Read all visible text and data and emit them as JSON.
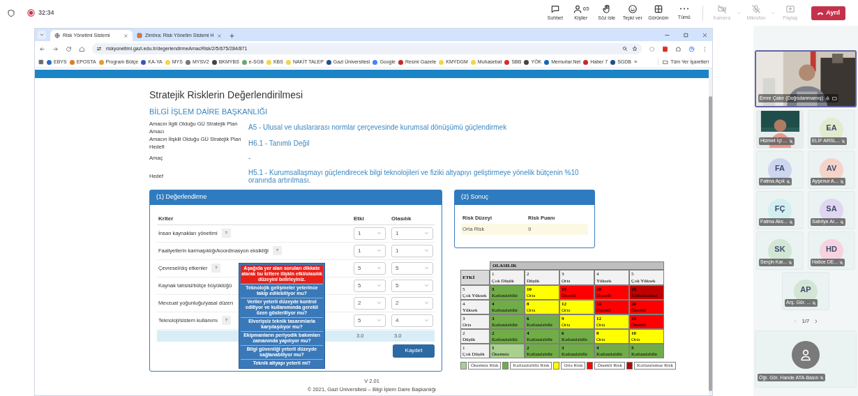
{
  "meeting_bar": {
    "timer": "32:34",
    "buttons": [
      {
        "kind": "chat",
        "label": "Sohbet",
        "disabled": false,
        "has_menu": false
      },
      {
        "kind": "people",
        "label": "Kişiler",
        "count": "65",
        "disabled": false,
        "has_menu": false
      },
      {
        "kind": "hand",
        "label": "Söz iste",
        "disabled": false,
        "has_menu": false
      },
      {
        "kind": "smile",
        "label": "Tepki ver",
        "disabled": false,
        "has_menu": false
      },
      {
        "kind": "grid",
        "label": "Görünüm",
        "disabled": false,
        "has_menu": false
      },
      {
        "kind": "more",
        "label": "Tümü",
        "disabled": false,
        "has_menu": false
      },
      {
        "kind": "camera",
        "label": "Kamera",
        "disabled": true,
        "has_menu": true
      },
      {
        "kind": "mic",
        "label": "Mikrofon",
        "disabled": true,
        "has_menu": true
      },
      {
        "kind": "share",
        "label": "Paylaş",
        "disabled": true,
        "has_menu": false
      }
    ],
    "leave": "Ayrıl"
  },
  "browser": {
    "tabs": [
      {
        "title": "Risk Yönetimi Sistemi",
        "selected": true
      },
      {
        "title": "Zimbra: Risk Yönetim Sistemi H",
        "selected": false
      }
    ],
    "url": "riskyonetimi.gazi.edu.tr/degerlendirmeAmacRisk/2/5/675/284/871",
    "bookmarks": [
      {
        "label": "EBYS",
        "color": "#2b6cc4"
      },
      {
        "label": "EPOSTA",
        "color": "#e07b22"
      },
      {
        "label": "Program Bütçe",
        "color": "#e89a2c"
      },
      {
        "label": "KA-YA",
        "color": "#3a55b8"
      },
      {
        "label": "MYS",
        "color": "#f2d64b"
      },
      {
        "label": "MYSV2",
        "color": "#777777"
      },
      {
        "label": "BKMYBS",
        "color": "#444444"
      },
      {
        "label": "e-SGB",
        "color": "#6aa86a"
      },
      {
        "label": "KBS",
        "color": "#f2d64b"
      },
      {
        "label": "NAKİT TALEP",
        "color": "#f2d64b"
      },
      {
        "label": "Gazi Üniversitesi",
        "color": "#1f4e8c"
      },
      {
        "label": "Google",
        "color": "#4285f4"
      },
      {
        "label": "Resmi Gazete",
        "color": "#c62828"
      },
      {
        "label": "KMYDGM",
        "color": "#f2d64b"
      },
      {
        "label": "Muhasebat",
        "color": "#f2d64b"
      },
      {
        "label": "SBB",
        "color": "#d32f2f"
      },
      {
        "label": "YÖK",
        "color": "#444444"
      },
      {
        "label": "Memurlar.Net",
        "color": "#1565c0"
      },
      {
        "label": "Haber 7",
        "color": "#c62828"
      },
      {
        "label": "SGDB",
        "color": "#1f4e8c"
      }
    ],
    "more": "»",
    "all_bookmarks": "Tüm Yer İşaretleri"
  },
  "page": {
    "title": "Stratejik Risklerin Değerlendirilmesi",
    "department": "BİLGİ İŞLEM DAİRE BAŞKANLIĞI",
    "fields": [
      {
        "label": "Amacın İlgili Olduğu GÜ Stratejik Plan Amacı",
        "value": "A5 - Ulusal ve uluslararası normlar çerçevesinde kurumsal dönüşümü güçlendirmek"
      },
      {
        "label": "Amacın İlişkili Olduğu GÜ Stratejik Plan Hedefi",
        "value": "H6.1 - Tanımlı Değil"
      },
      {
        "label": "Amaç",
        "value": "-"
      },
      {
        "label": "Hedef",
        "value": "H5.1 - Kurumsallaşmayı güçlendirecek bilgi teknolojileri ve fiziki altyapıyı geliştirmeye yönelik bütçenin %10 oranında artırılması."
      }
    ],
    "evaluation": {
      "title": "(1) Değerlendirme",
      "columns": [
        "Kriter",
        "Etki",
        "Olasılık"
      ],
      "rows": [
        {
          "criterion": "İnsan kaynakları yönetimi",
          "help": true,
          "etki": "1",
          "olasilik": "1"
        },
        {
          "criterion": "Faaliyetlerin karmaşıklığı/koordinasyon eksikliği",
          "help": true,
          "etki": "1",
          "olasilik": "1"
        },
        {
          "criterion": "Çevresel/dış etkenler",
          "help": true,
          "etki": "5",
          "olasilik": "5"
        },
        {
          "criterion": "Kaynak tahsisi/bütçe büyüklüğü",
          "help": false,
          "etki": "5",
          "olasilik": "5"
        },
        {
          "criterion": "Mevzuat yoğunluğu/yasal düzen",
          "help": false,
          "etki": "2",
          "olasilik": "2"
        },
        {
          "criterion": "Teknoloji/sistem kullanımı",
          "help": true,
          "etki": "5",
          "olasilik": "4"
        }
      ],
      "totals": [
        "3.0",
        "3.0"
      ],
      "save": "Kaydet",
      "help_label": "?"
    },
    "tooltip": {
      "header": "Aşağıda yer alan soruları dikkate alarak bu kritere ilişkin etki/olasılık düzeyini belirleyiniz.",
      "questions": [
        "Teknolojik gelişmeler yeterince takip edilebiliyor mu?",
        "Veriler yeterli düzeyde kontrol ediliyor ve kullanımında gerekli özen gösteriliyor mu?",
        "Elverişsiz teknik tasarımlarla karşılaşılıyor mu?",
        "Ekipmanların periyodik bakımları zamanında yapılıyor mu?",
        "Bilgi güvenliği yeterli düzeyde sağlanabiliyor mu?",
        "Teknik altyapı yeterli mi?"
      ]
    },
    "result": {
      "title": "(2) Sonuç",
      "columns": [
        "Risk Düzeyi",
        "Risk Puanı"
      ],
      "rows": [
        [
          "Orta Risk",
          "9"
        ]
      ]
    },
    "matrix": {
      "header": "OLASILIK",
      "corner": "ETKİ",
      "columns": [
        {
          "num": "1",
          "label": "Çok Düşük"
        },
        {
          "num": "2",
          "label": "Düşük"
        },
        {
          "num": "3",
          "label": "Orta"
        },
        {
          "num": "4",
          "label": "Yüksek"
        },
        {
          "num": "5",
          "label": "Çok Yüksek"
        }
      ],
      "rows": [
        {
          "num": "5",
          "label": "Çok Yüksek",
          "cells": [
            {
              "score": "5",
              "label": "Katlanılabilir",
              "color": "#70ad47"
            },
            {
              "score": "10",
              "label": "Orta",
              "color": "#ffff00"
            },
            {
              "score": "15",
              "label": "Önemli",
              "color": "#ff0000"
            },
            {
              "score": "20",
              "label": "Önemli",
              "color": "#ff0000"
            },
            {
              "score": "25",
              "label": "Katlanılamaz",
              "color": "#c00000"
            }
          ]
        },
        {
          "num": "4",
          "label": "Yüksek",
          "cells": [
            {
              "score": "4",
              "label": "Katlanılabilir",
              "color": "#70ad47"
            },
            {
              "score": "8",
              "label": "Orta",
              "color": "#ffff00"
            },
            {
              "score": "12",
              "label": "Orta",
              "color": "#ffff00"
            },
            {
              "score": "16",
              "label": "Önemli",
              "color": "#ff0000"
            },
            {
              "score": "20",
              "label": "Önemli",
              "color": "#ff0000"
            }
          ]
        },
        {
          "num": "3",
          "label": "Orta",
          "cells": [
            {
              "score": "3",
              "label": "Katlanılabilir",
              "color": "#70ad47"
            },
            {
              "score": "6",
              "label": "Katlanılabilir",
              "color": "#70ad47"
            },
            {
              "score": "9",
              "label": "Orta",
              "color": "#ffff00"
            },
            {
              "score": "12",
              "label": "Orta",
              "color": "#ffff00"
            },
            {
              "score": "15",
              "label": "Önemli",
              "color": "#ff0000"
            }
          ]
        },
        {
          "num": "2",
          "label": "Düşük",
          "cells": [
            {
              "score": "2",
              "label": "Katlanılabilir",
              "color": "#70ad47"
            },
            {
              "score": "4",
              "label": "Katlanılabilir",
              "color": "#70ad47"
            },
            {
              "score": "6",
              "label": "Katlanılabilir",
              "color": "#70ad47"
            },
            {
              "score": "8",
              "label": "Orta",
              "color": "#ffff00"
            },
            {
              "score": "10",
              "label": "Orta",
              "color": "#ffff00"
            }
          ]
        },
        {
          "num": "1",
          "label": "Çok Düşük",
          "cells": [
            {
              "score": "1",
              "label": "Önemsiz",
              "color": "#a9d08e"
            },
            {
              "score": "2",
              "label": "Katlanılabilir",
              "color": "#70ad47"
            },
            {
              "score": "3",
              "label": "Katlanılabilir",
              "color": "#70ad47"
            },
            {
              "score": "4",
              "label": "Katlanılabilir",
              "color": "#70ad47"
            },
            {
              "score": "5",
              "label": "Katlanılabilir",
              "color": "#70ad47"
            }
          ]
        }
      ],
      "legend": [
        {
          "label": "Önemsiz Risk",
          "color": "#a9d08e"
        },
        {
          "label": "Katlanılabilir Risk",
          "color": "#70ad47"
        },
        {
          "label": "Orta Risk",
          "color": "#ffff00"
        },
        {
          "label": "Önemli Risk",
          "color": "#ff0000"
        },
        {
          "label": "Katlanılamaz Risk",
          "color": "#c00000"
        }
      ]
    },
    "footer": {
      "version": "V 2.01",
      "copyright": "© 2021, Gazi Üniversitesi – Bilgi İşlem Daire Başkanlığı"
    }
  },
  "participants": {
    "featured": {
      "kind": "video",
      "name": "Emre Çakır (Doğrulanmamış)"
    },
    "tiles": [
      {
        "kind": "video",
        "name": "Hizmet İçi ..."
      },
      {
        "kind": "avatar",
        "initials": "EA",
        "name": "ELİF ARSL...",
        "color": "#e3ebcf"
      },
      {
        "kind": "avatar",
        "initials": "FA",
        "name": "Fatma Açık",
        "color": "#cdd6ee"
      },
      {
        "kind": "avatar",
        "initials": "AV",
        "name": "Ayşenur A...",
        "color": "#f6d3c9"
      },
      {
        "kind": "avatar",
        "initials": "FÇ",
        "name": "Fatma Aks...",
        "color": "#d3eef0"
      },
      {
        "kind": "avatar",
        "initials": "SA",
        "name": "Sabriye Ar...",
        "color": "#e0d6ef"
      },
      {
        "kind": "avatar",
        "initials": "SK",
        "name": "Serçin Kar...",
        "color": "#d2e6d5"
      },
      {
        "kind": "avatar",
        "initials": "HD",
        "name": "Hatice DE...",
        "color": "#f6d3df"
      },
      {
        "kind": "avatar",
        "initials": "AP",
        "name": "Arş. Gör. ...",
        "color": "#d3e6d6"
      }
    ],
    "pager": "1/7",
    "bottom": {
      "name": "Öğr. Gör. Hande ATA-Basın"
    }
  }
}
